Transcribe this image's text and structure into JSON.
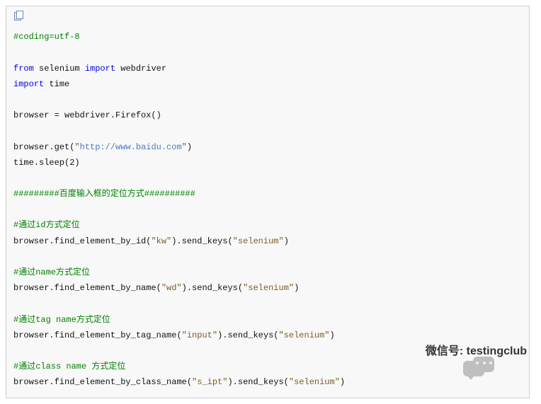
{
  "code": {
    "l1": "#coding=utf-8",
    "l2": " ",
    "l3a": "from",
    "l3b": " selenium ",
    "l3c": "import",
    "l3d": " webdriver",
    "l4a": "import",
    "l4b": " time",
    "l5": " ",
    "l6": "browser = webdriver.Firefox()",
    "l7": " ",
    "l8a": "browser.get(",
    "l8b": "\"",
    "l8c": "http://www.baidu.com",
    "l8d": "\"",
    "l8e": ")",
    "l9": "time.sleep(2)",
    "l10": " ",
    "l11": "#########百度输入框的定位方式##########",
    "l12": " ",
    "l13": "#通过id方式定位",
    "l14a": "browser.find_element_by_id(",
    "l14b": "\"kw\"",
    "l14c": ").send_keys(",
    "l14d": "\"selenium\"",
    "l14e": ")",
    "l15": " ",
    "l16": "#通过name方式定位",
    "l17a": "browser.find_element_by_name(",
    "l17b": "\"wd\"",
    "l17c": ").send_keys(",
    "l17d": "\"selenium\"",
    "l17e": ")",
    "l18": " ",
    "l19": "#通过tag name方式定位",
    "l20a": "browser.find_element_by_tag_name(",
    "l20b": "\"input\"",
    "l20c": ").send_keys(",
    "l20d": "\"selenium\"",
    "l20e": ")",
    "l21": " ",
    "l22": "#通过class name 方式定位",
    "l23a": "browser.find_element_by_class_name(",
    "l23b": "\"s_ipt\"",
    "l23c": ").send_keys(",
    "l23d": "\"selenium\"",
    "l23e": ")"
  },
  "watermark": {
    "label": "微信号",
    "value": "testingclub"
  }
}
